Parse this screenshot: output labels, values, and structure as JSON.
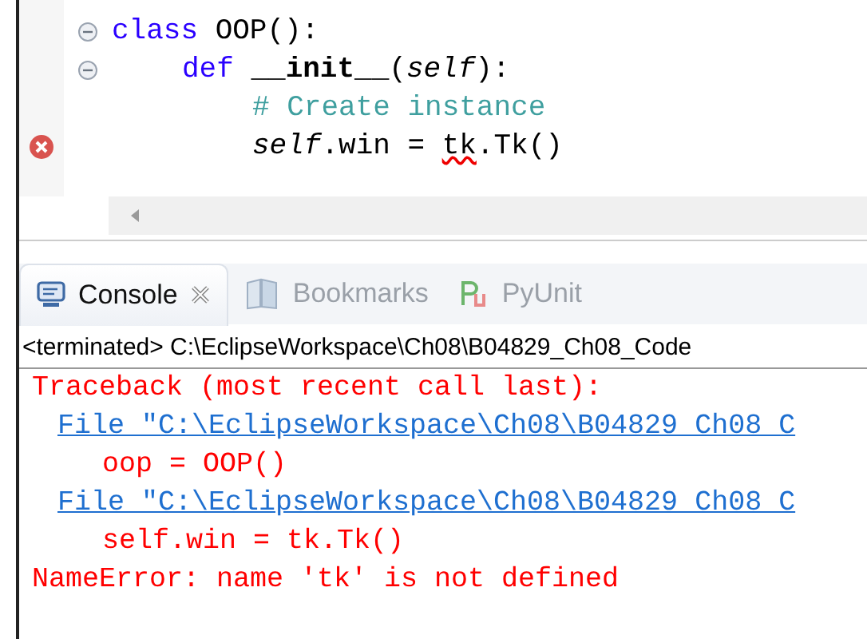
{
  "editor": {
    "lines": [
      {
        "kind": "fold",
        "tokens": [
          {
            "text": "class",
            "kind": "keyword"
          },
          {
            "text": " OOP():",
            "kind": "plain"
          }
        ],
        "children": [
          {
            "kind": "fold",
            "tokens": [
              {
                "text": "def ",
                "kind": "keyword"
              },
              {
                "text": "__init__",
                "kind": "bold"
              },
              {
                "text": "(",
                "kind": "plain"
              },
              {
                "text": "self",
                "kind": "italic"
              },
              {
                "text": "):",
                "kind": "plain"
              }
            ],
            "children": [
              {
                "kind": "plain",
                "tokens": [
                  {
                    "text": "# Create instance",
                    "kind": "comment"
                  }
                ]
              },
              {
                "kind": "error",
                "tokens": [
                  {
                    "text": "self",
                    "kind": "italic"
                  },
                  {
                    "text": ".win = ",
                    "kind": "plain"
                  },
                  {
                    "text": "tk",
                    "kind": "error"
                  },
                  {
                    "text": ".Tk()",
                    "kind": "plain"
                  }
                ]
              }
            ]
          }
        ]
      }
    ]
  },
  "tabs": [
    {
      "label": "Console",
      "selected": true
    },
    {
      "label": "Bookmarks",
      "selected": false
    },
    {
      "label": "PyUnit",
      "selected": false
    }
  ],
  "console": {
    "header": "<terminated> C:\\EclipseWorkspace\\Ch08\\B04829_Ch08_Code",
    "lines": [
      {
        "kind": "error",
        "text": "Traceback (most recent call last):"
      },
      {
        "kind": "link",
        "text": "File \"C:\\EclipseWorkspace\\Ch08\\B04829 Ch08 C"
      },
      {
        "kind": "source",
        "text": "oop = OOP()"
      },
      {
        "kind": "link",
        "text": "File \"C:\\EclipseWorkspace\\Ch08\\B04829 Ch08 C"
      },
      {
        "kind": "source",
        "text": "self.win = tk.Tk()"
      },
      {
        "kind": "error",
        "text": "NameError: name 'tk' is not defined"
      }
    ]
  }
}
